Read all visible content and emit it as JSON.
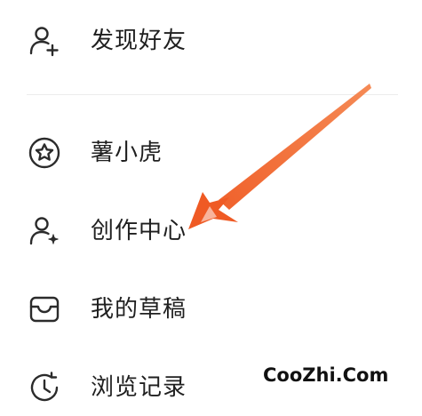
{
  "menu": {
    "items": [
      {
        "label": "发现好友",
        "icon": "add-user-icon"
      },
      {
        "label": "薯小虎",
        "icon": "star-badge-icon"
      },
      {
        "label": "创作中心",
        "icon": "creator-user-sparkle-icon"
      },
      {
        "label": "我的草稿",
        "icon": "draft-box-icon"
      },
      {
        "label": "浏览记录",
        "icon": "history-clock-icon"
      }
    ]
  },
  "annotation": {
    "arrow_color": "#f0622e",
    "target": "创作中心"
  },
  "watermark": {
    "text": "CooZhi.Com"
  },
  "colors": {
    "text": "#1f1f1f",
    "icon": "#2b2b2b",
    "divider": "#ececec",
    "background": "#ffffff"
  }
}
